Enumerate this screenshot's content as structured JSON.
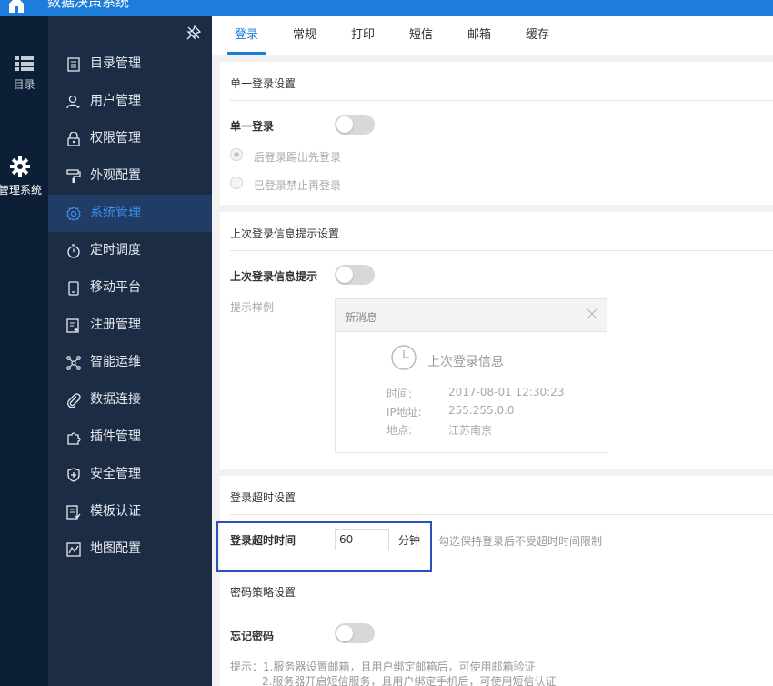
{
  "header": {
    "title": "数据决策系统"
  },
  "strip": {
    "items": [
      {
        "label": "目录",
        "icon": "list-icon"
      },
      {
        "label": "管理系统",
        "icon": "gear-icon"
      }
    ]
  },
  "sidebar": {
    "items": [
      {
        "label": "目录管理",
        "icon": "catalog-icon"
      },
      {
        "label": "用户管理",
        "icon": "user-icon"
      },
      {
        "label": "权限管理",
        "icon": "lock-icon"
      },
      {
        "label": "外观配置",
        "icon": "paint-roller-icon"
      },
      {
        "label": "系统管理",
        "icon": "settings-icon",
        "active": true
      },
      {
        "label": "定时调度",
        "icon": "timer-icon"
      },
      {
        "label": "移动平台",
        "icon": "mobile-icon"
      },
      {
        "label": "注册管理",
        "icon": "register-icon"
      },
      {
        "label": "智能运维",
        "icon": "network-icon"
      },
      {
        "label": "数据连接",
        "icon": "paperclip-icon"
      },
      {
        "label": "插件管理",
        "icon": "puzzle-icon"
      },
      {
        "label": "安全管理",
        "icon": "shield-icon"
      },
      {
        "label": "模板认证",
        "icon": "template-icon"
      },
      {
        "label": "地图配置",
        "icon": "map-icon"
      }
    ]
  },
  "tabs": [
    "登录",
    "常规",
    "打印",
    "短信",
    "邮箱",
    "缓存"
  ],
  "single_login": {
    "section_title": "单一登录设置",
    "label": "单一登录",
    "options": [
      "后登录踢出先登录",
      "已登录禁止再登录"
    ]
  },
  "last_login": {
    "section_title": "上次登录信息提示设置",
    "label": "上次登录信息提示",
    "sample_label": "提示样例",
    "notice_title": "新消息",
    "notice_text": "上次登录信息",
    "rows": [
      {
        "key": "时间:",
        "value": "2017-08-01 12:30:23"
      },
      {
        "key": "IP地址:",
        "value": "255.255.0.0"
      },
      {
        "key": "地点:",
        "value": "江苏南京"
      }
    ]
  },
  "timeout": {
    "section_title": "登录超时设置",
    "label": "登录超时时间",
    "value": "60",
    "unit": "分钟",
    "hint": "勾选保持登录后不受超时时间限制"
  },
  "password": {
    "section_title": "密码策略设置",
    "label": "忘记密码",
    "tip_line1": "提示：1.服务器设置邮箱，且用户绑定邮箱后，可使用邮箱验证",
    "tip_line2": "2.服务器开启短信服务，且用户绑定手机后，可使用短信认证"
  },
  "colors": {
    "header": "#1e7ddb",
    "strip": "#0d1f37",
    "sidebar": "#1c2c44",
    "sidebar_active": "#213d66",
    "accent": "#1e7ddb",
    "highlight_border": "#2b4fc0"
  }
}
